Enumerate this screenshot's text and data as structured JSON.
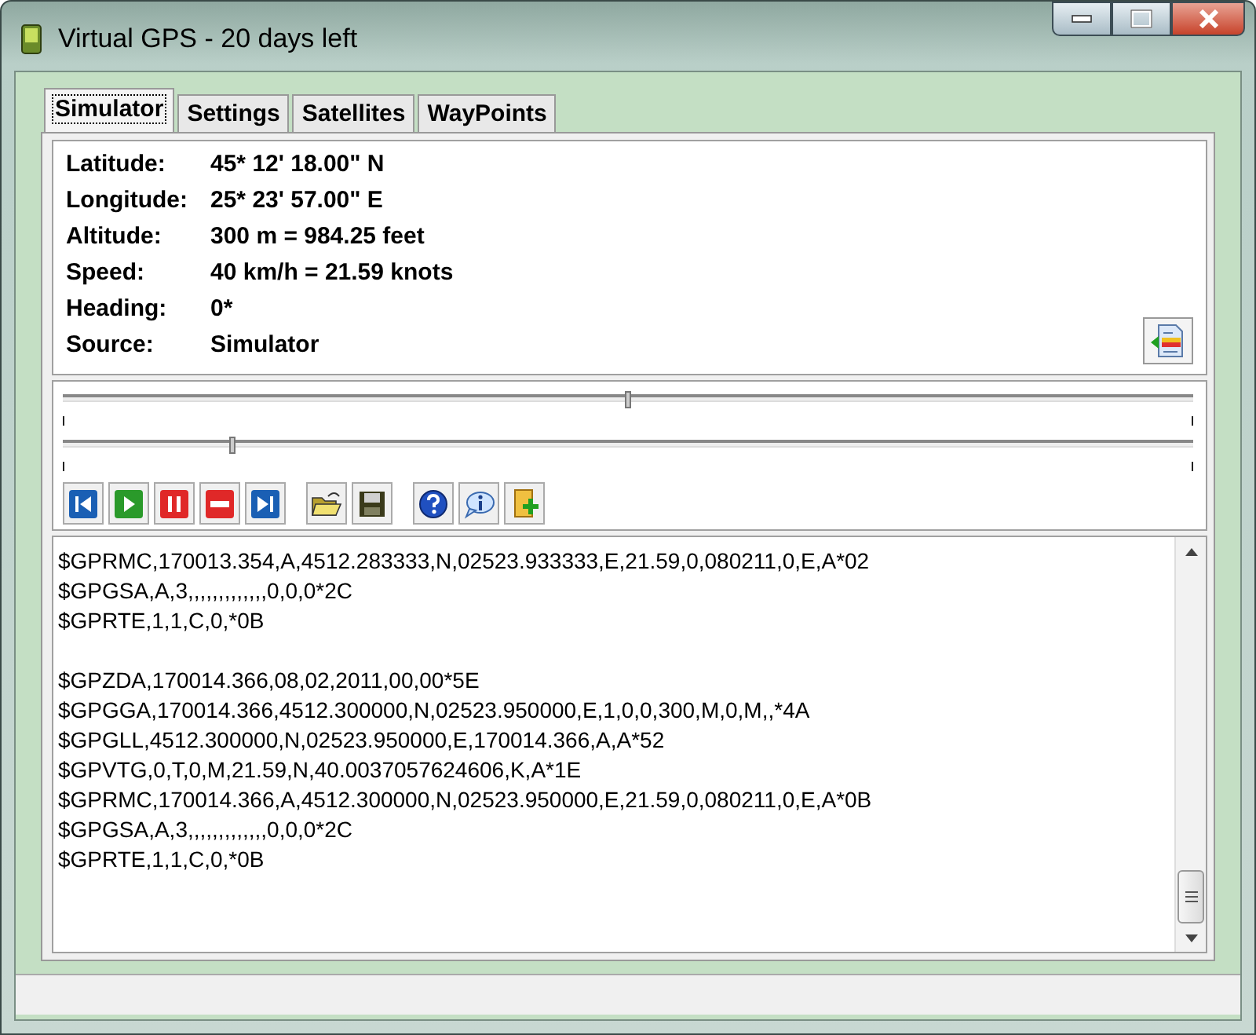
{
  "window": {
    "title": "Virtual GPS - 20 days left"
  },
  "tabs": [
    {
      "label": "Simulator",
      "selected": true
    },
    {
      "label": "Settings",
      "selected": false
    },
    {
      "label": "Satellites",
      "selected": false
    },
    {
      "label": "WayPoints",
      "selected": false
    }
  ],
  "info": [
    {
      "label": "Latitude:",
      "value": "45* 12' 18.00\" N"
    },
    {
      "label": "Longitude:",
      "value": "25* 23' 57.00\" E"
    },
    {
      "label": "Altitude:",
      "value": "300 m = 984.25 feet"
    },
    {
      "label": "Speed:",
      "value": "40 km/h = 21.59 knots"
    },
    {
      "label": "Heading:",
      "value": "0*"
    },
    {
      "label": "Source:",
      "value": "Simulator"
    }
  ],
  "sliders": [
    {
      "level": 0.5
    },
    {
      "level": 0.15
    }
  ],
  "log": {
    "blocks": [
      [
        "$GPRMC,170013.354,A,4512.283333,N,02523.933333,E,21.59,0,080211,0,E,A*02",
        "$GPGSA,A,3,,,,,,,,,,,,,0,0,0*2C",
        "$GPRTE,1,1,C,0,*0B"
      ],
      [
        "$GPZDA,170014.366,08,02,2011,00,00*5E",
        "$GPGGA,170014.366,4512.300000,N,02523.950000,E,1,0,0,300,M,0,M,,*4A",
        "$GPGLL,4512.300000,N,02523.950000,E,170014.366,A,A*52",
        "$GPVTG,0,T,0,M,21.59,N,40.0037057624606,K,A*1E",
        "$GPRMC,170014.366,A,4512.300000,N,02523.950000,E,21.59,0,080211,0,E,A*0B",
        "$GPGSA,A,3,,,,,,,,,,,,,0,0,0*2C",
        "$GPRTE,1,1,C,0,*0B"
      ]
    ]
  }
}
